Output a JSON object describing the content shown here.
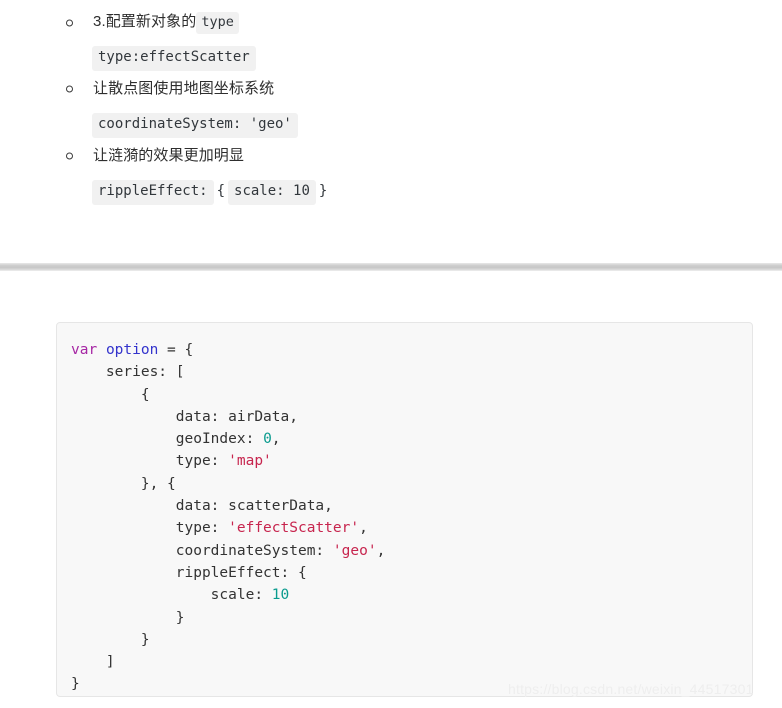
{
  "notes": {
    "items": [
      {
        "marker": "hollow-circle-bullet",
        "text": "3.配置新对象的",
        "inline_code": "type"
      },
      {
        "code_line": "type:effectScatter"
      },
      {
        "marker": "hollow-circle-bullet",
        "text": "让散点图使用地图坐标系统"
      },
      {
        "code_line": "coordinateSystem: 'geo'"
      },
      {
        "marker": "hollow-circle-bullet",
        "text": "让涟漪的效果更加明显"
      },
      {
        "code_chip_a": "rippleEffect:",
        "plain_a": "{",
        "code_chip_b": "scale: 10",
        "plain_b": "}"
      }
    ]
  },
  "code_block": {
    "language": "javascript",
    "lines": [
      {
        "tokens": [
          {
            "t": "var",
            "c": "kw"
          },
          {
            "t": " ",
            "c": "pun"
          },
          {
            "t": "option",
            "c": "var"
          },
          {
            "t": " = {",
            "c": "pun"
          }
        ]
      },
      {
        "tokens": [
          {
            "t": "    series: [",
            "c": "pun"
          }
        ]
      },
      {
        "tokens": [
          {
            "t": "        {",
            "c": "pun"
          }
        ]
      },
      {
        "tokens": [
          {
            "t": "            data: airData,",
            "c": "pun"
          }
        ]
      },
      {
        "tokens": [
          {
            "t": "            geoIndex: ",
            "c": "pun"
          },
          {
            "t": "0",
            "c": "num"
          },
          {
            "t": ",",
            "c": "pun"
          }
        ]
      },
      {
        "tokens": [
          {
            "t": "            type: ",
            "c": "pun"
          },
          {
            "t": "'map'",
            "c": "str"
          }
        ]
      },
      {
        "tokens": [
          {
            "t": "        }, {",
            "c": "pun"
          }
        ]
      },
      {
        "tokens": [
          {
            "t": "            data: scatterData,",
            "c": "pun"
          }
        ]
      },
      {
        "tokens": [
          {
            "t": "            type: ",
            "c": "pun"
          },
          {
            "t": "'effectScatter'",
            "c": "str"
          },
          {
            "t": ",",
            "c": "pun"
          }
        ]
      },
      {
        "tokens": [
          {
            "t": "            coordinateSystem: ",
            "c": "pun"
          },
          {
            "t": "'geo'",
            "c": "str"
          },
          {
            "t": ",",
            "c": "pun"
          }
        ]
      },
      {
        "tokens": [
          {
            "t": "            rippleEffect: {",
            "c": "pun"
          }
        ]
      },
      {
        "tokens": [
          {
            "t": "                scale: ",
            "c": "pun"
          },
          {
            "t": "10",
            "c": "num"
          }
        ]
      },
      {
        "tokens": [
          {
            "t": "            }",
            "c": "pun"
          }
        ]
      },
      {
        "tokens": [
          {
            "t": "        }",
            "c": "pun"
          }
        ]
      },
      {
        "tokens": [
          {
            "t": "    ]",
            "c": "pun"
          }
        ]
      },
      {
        "tokens": [
          {
            "t": "}",
            "c": "pun"
          }
        ]
      }
    ]
  },
  "watermark": {
    "text": "https://blog.csdn.net/weixin_44517301"
  },
  "colors": {
    "keyword": "#a626a4",
    "variable": "#3333cc",
    "string": "#c7254e",
    "number": "#0a9b8e",
    "code_bg": "#f8f8f8",
    "chip_bg": "#f1f1f1",
    "divider": "#c6c6c6",
    "watermark": "#eeeeee"
  }
}
